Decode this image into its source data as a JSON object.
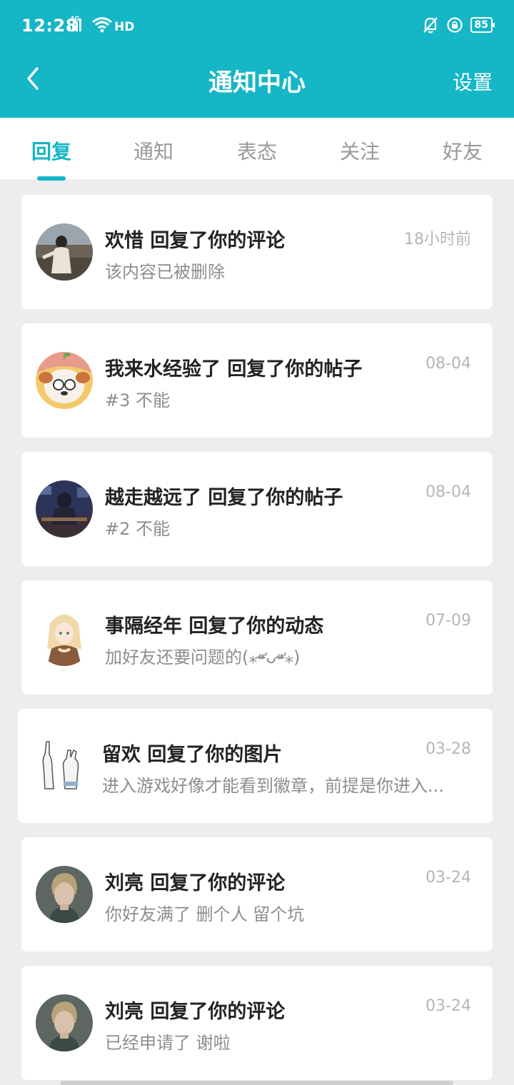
{
  "theme": {
    "accent": "#15b6c6"
  },
  "status_bar": {
    "time": "12:28",
    "network_tag": "4G",
    "hd_label": "HD",
    "battery": "85",
    "icons": [
      "signal-icon",
      "wifi-icon",
      "bell-mute-icon",
      "rotation-lock-icon",
      "battery-icon"
    ]
  },
  "header": {
    "title": "通知中心",
    "settings_label": "设置",
    "back_icon": "back-icon"
  },
  "tabs": [
    {
      "label": "回复",
      "active": true
    },
    {
      "label": "通知",
      "active": false
    },
    {
      "label": "表态",
      "active": false
    },
    {
      "label": "关注",
      "active": false
    },
    {
      "label": "好友",
      "active": false
    }
  ],
  "messages": [
    {
      "name": "欢惜 回复了你的评论",
      "time": "18小时前",
      "content": "该内容已被删除"
    },
    {
      "name": "我来水经验了 回复了你的帖子",
      "time": "08-04",
      "content": "#3 不能"
    },
    {
      "name": "越走越远了 回复了你的帖子",
      "time": "08-04",
      "content": "#2 不能"
    },
    {
      "name": "事隔经年 回复了你的动态",
      "time": "07-09",
      "content": "加好友还要问题的(⁎⁍̴̛ᴗ⁍̴̛⁎)"
    },
    {
      "name": "留欢 回复了你的图片",
      "time": "03-28",
      "content": "进入游戏好像才能看到徽章，前提是你进入..."
    },
    {
      "name": "刘亮 回复了你的评论",
      "time": "03-24",
      "content": "你好友满了 删个人 留个坑"
    },
    {
      "name": "刘亮 回复了你的评论",
      "time": "03-24",
      "content": "已经申请了 谢啦"
    }
  ]
}
